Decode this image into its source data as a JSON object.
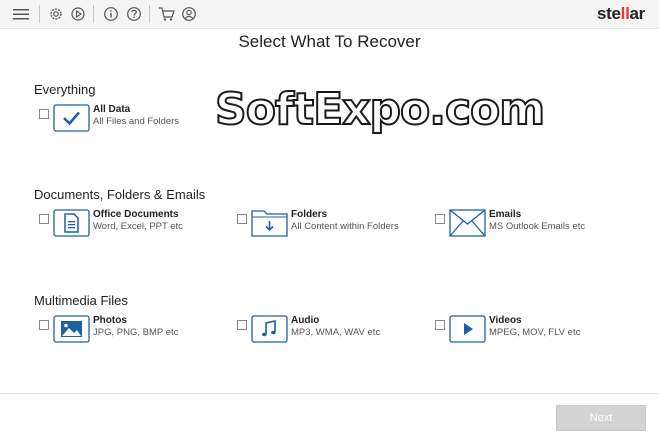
{
  "app": {
    "logo_text": "stellar"
  },
  "toolbar": {
    "icons": [
      "menu-icon",
      "settings-icon",
      "resume-icon",
      "info-icon",
      "help-icon",
      "cart-icon",
      "account-icon"
    ]
  },
  "title": "Select What To Recover",
  "sections": [
    {
      "title": "Everything",
      "options": [
        {
          "label": "All Data",
          "sub": "All Files and Folders",
          "icon": "checkmark-icon",
          "checked": false
        }
      ]
    },
    {
      "title": "Documents, Folders & Emails",
      "options": [
        {
          "label": "Office Documents",
          "sub": "Word, Excel, PPT etc",
          "icon": "document-icon",
          "checked": false
        },
        {
          "label": "Folders",
          "sub": "All Content within Folders",
          "icon": "folder-icon",
          "checked": false
        },
        {
          "label": "Emails",
          "sub": "MS Outlook Emails etc",
          "icon": "email-icon",
          "checked": false
        }
      ]
    },
    {
      "title": "Multimedia Files",
      "options": [
        {
          "label": "Photos",
          "sub": "JPG, PNG, BMP etc",
          "icon": "photo-icon",
          "checked": false
        },
        {
          "label": "Audio",
          "sub": "MP3, WMA, WAV etc",
          "icon": "music-icon",
          "checked": false
        },
        {
          "label": "Videos",
          "sub": "MPEG, MOV, FLV etc",
          "icon": "video-icon",
          "checked": false
        }
      ]
    }
  ],
  "footer": {
    "next_label": "Next",
    "next_enabled": false
  },
  "watermark": "SoftExpo.com",
  "colors": {
    "accent": "#1f5fa8",
    "logo_accent": "#e23a2e",
    "button_disabled": "#d3d3d3"
  }
}
